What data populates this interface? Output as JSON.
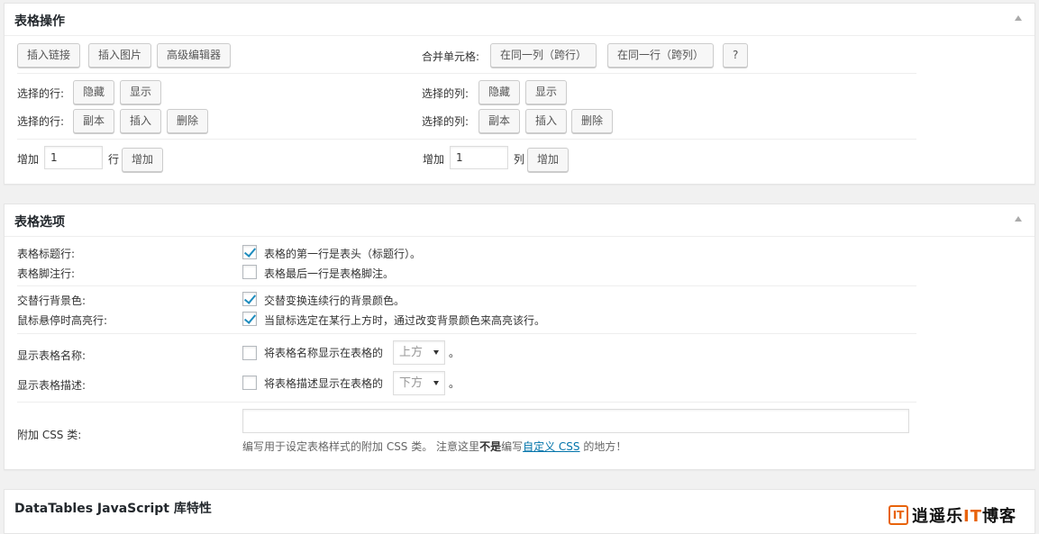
{
  "table_ops": {
    "title": "表格操作",
    "insert_link": "插入链接",
    "insert_image": "插入图片",
    "advanced_editor": "高级编辑器",
    "merge_label": "合并单元格:",
    "merge_col": "在同一列（跨行）",
    "merge_row": "在同一行（跨列）",
    "help": "?",
    "rows_label": "选择的行:",
    "cols_label": "选择的列:",
    "hide": "隐藏",
    "show": "显示",
    "duplicate": "副本",
    "insert": "插入",
    "delete": "删除",
    "add_label": "增加",
    "add_rows_value": "1",
    "rows_unit": "行",
    "add_cols_value": "1",
    "cols_unit": "列",
    "add_button": "增加"
  },
  "table_options": {
    "title": "表格选项",
    "header_row": {
      "label": "表格标题行:",
      "text": "表格的第一行是表头（标题行）。",
      "checked": true
    },
    "footer_row": {
      "label": "表格脚注行:",
      "text": "表格最后一行是表格脚注。",
      "checked": false
    },
    "alt_bg": {
      "label": "交替行背景色:",
      "text": "交替变换连续行的背景颜色。",
      "checked": true
    },
    "hover": {
      "label": "鼠标悬停时高亮行:",
      "text": "当鼠标选定在某行上方时，通过改变背景颜色来高亮该行。",
      "checked": true
    },
    "show_name": {
      "label": "显示表格名称:",
      "text": "将表格名称显示在表格的",
      "select": "上方",
      "suffix": "。",
      "checked": false
    },
    "show_desc": {
      "label": "显示表格描述:",
      "text": "将表格描述显示在表格的",
      "select": "下方",
      "suffix": "。",
      "checked": false
    },
    "css": {
      "label": "附加 CSS 类:",
      "value": "",
      "help_pre": "编写用于设定表格样式的附加 CSS 类。 注意这里",
      "help_bold": "不是",
      "help_mid": "编写",
      "help_link": "自定义 CSS",
      "help_post": " 的地方！"
    }
  },
  "datatables": {
    "title": "DataTables JavaScript 库特性"
  },
  "watermark": {
    "mark": "IT",
    "text_a": "逍遥乐",
    "text_b": "IT",
    "text_c": "博客"
  },
  "colors": {
    "link": "#0073aa",
    "checkmark": "#1e8cbe",
    "logo_accent": "#e8630a"
  }
}
